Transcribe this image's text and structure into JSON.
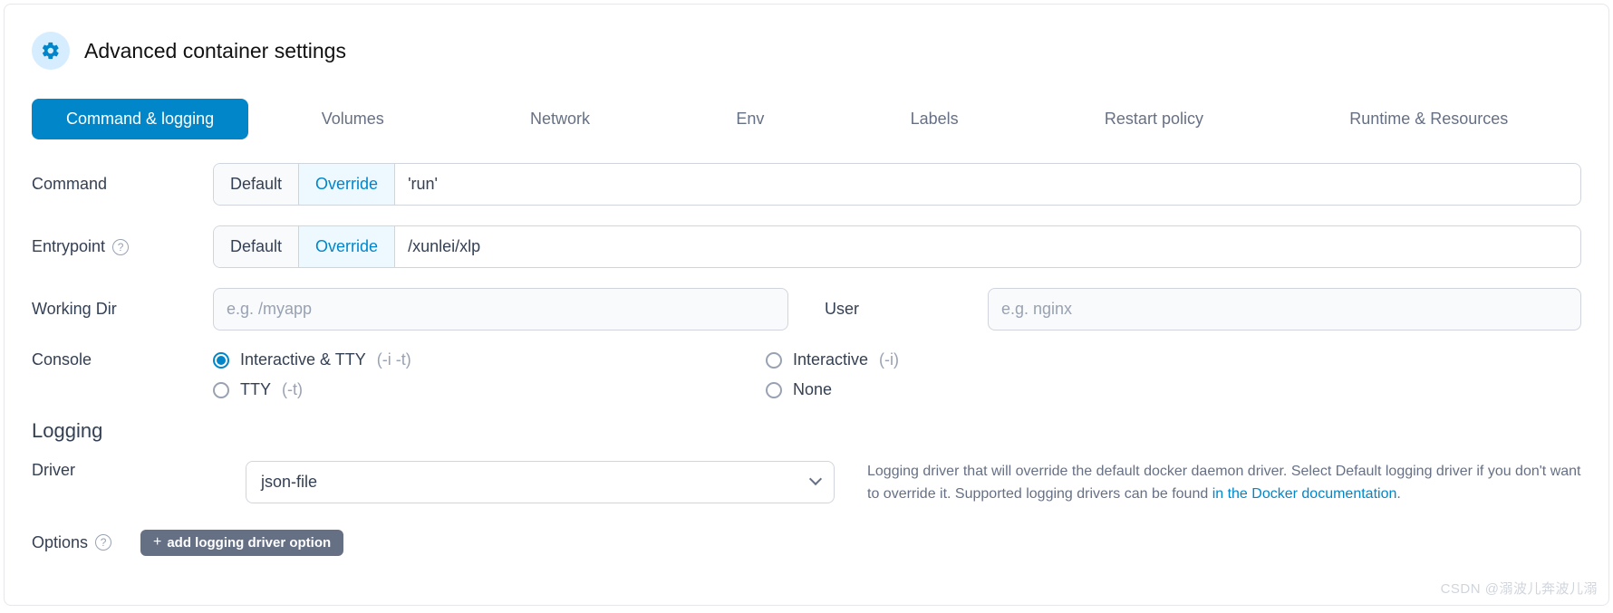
{
  "header": {
    "title": "Advanced container settings"
  },
  "tabs": {
    "active": "Command & logging",
    "others": [
      "Volumes",
      "Network",
      "Env",
      "Labels",
      "Restart policy",
      "Runtime & Resources"
    ]
  },
  "command": {
    "label": "Command",
    "default_btn": "Default",
    "override_btn": "Override",
    "value": "'run'"
  },
  "entrypoint": {
    "label": "Entrypoint",
    "default_btn": "Default",
    "override_btn": "Override",
    "value": "/xunlei/xlp"
  },
  "workingdir": {
    "label": "Working Dir",
    "placeholder": "e.g. /myapp"
  },
  "user": {
    "label": "User",
    "placeholder": "e.g. nginx"
  },
  "console": {
    "label": "Console",
    "options": {
      "interactive_tty": {
        "label": "Interactive & TTY",
        "hint": "(-i -t)",
        "checked": true
      },
      "interactive": {
        "label": "Interactive",
        "hint": "(-i)",
        "checked": false
      },
      "tty": {
        "label": "TTY",
        "hint": "(-t)",
        "checked": false
      },
      "none": {
        "label": "None",
        "hint": "",
        "checked": false
      }
    }
  },
  "logging": {
    "title": "Logging",
    "driver_label": "Driver",
    "driver_value": "json-file",
    "help_text_1": "Logging driver that will override the default docker daemon driver. Select Default logging driver if you don't want to override it. Supported logging drivers can be found ",
    "help_link": "in the Docker documentation",
    "help_text_2": ".",
    "options_label": "Options",
    "add_button": "add logging driver option"
  },
  "watermark": "CSDN @溺波儿奔波儿溺"
}
